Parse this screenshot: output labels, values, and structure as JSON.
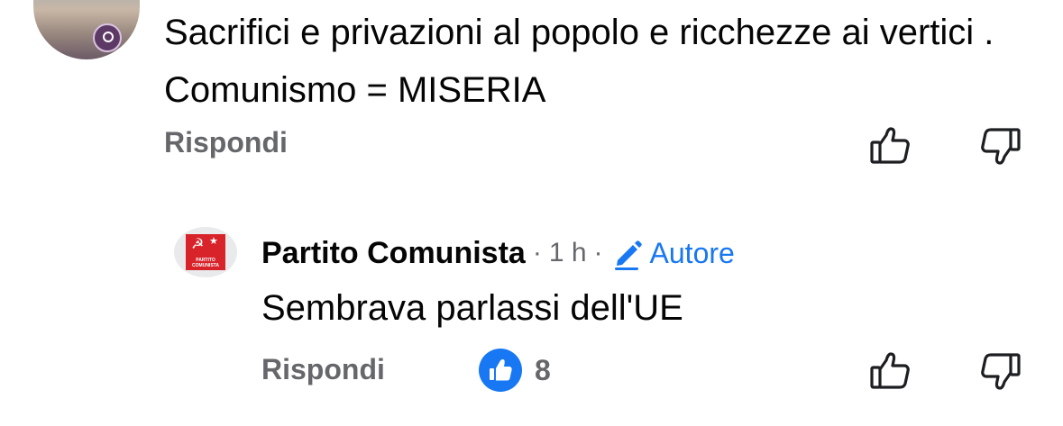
{
  "comment": {
    "avatar_icon": "user-avatar-photo",
    "text": "Sacrifici e privazioni al popolo e  ricchezze ai vertici . Comunismo = MISERIA",
    "reply_label": "Rispondi"
  },
  "reply": {
    "author": "Partito Comunista",
    "separator1": "·",
    "time": "1 h",
    "separator2": "·",
    "badge_label": "Autore",
    "text": "Sembrava parlassi dell'UE",
    "reply_label": "Rispondi",
    "like_count": "8",
    "logo_text": "PARTITO COMUNISTA"
  },
  "colors": {
    "accent": "#1877f2",
    "secondary_text": "#65676b",
    "logo_red": "#d8232a"
  },
  "icons": {
    "like": "thumbs-up-icon",
    "dislike": "thumbs-down-icon",
    "author_badge": "pencil-icon"
  }
}
